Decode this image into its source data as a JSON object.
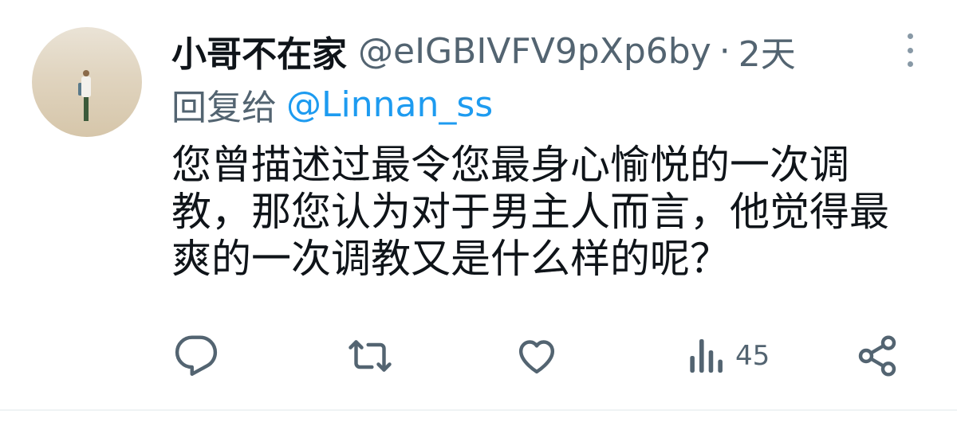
{
  "tweet": {
    "display_name": "小哥不在家",
    "handle": "@eIGBIVFV9pXp6by",
    "separator": "·",
    "time": "2天",
    "reply_prefix": "回复给",
    "reply_to": "@Linnan_ss",
    "text_lines": [
      "您曾描述过最令您最身心愉悦的一次调",
      "教，那您认为对于男主人而言，他觉得最",
      "爽的一次调教又是什么样的呢？"
    ]
  },
  "actions": {
    "views": "45"
  },
  "icons": {
    "reply": "reply-icon",
    "retweet": "retweet-icon",
    "like": "heart-icon",
    "views": "views-bar-chart-icon",
    "share": "share-icon",
    "more": "more-vertical-icon"
  },
  "colors": {
    "text": "#0f1419",
    "secondary": "#536471",
    "link": "#1d9bf0",
    "icon": "#536471"
  }
}
